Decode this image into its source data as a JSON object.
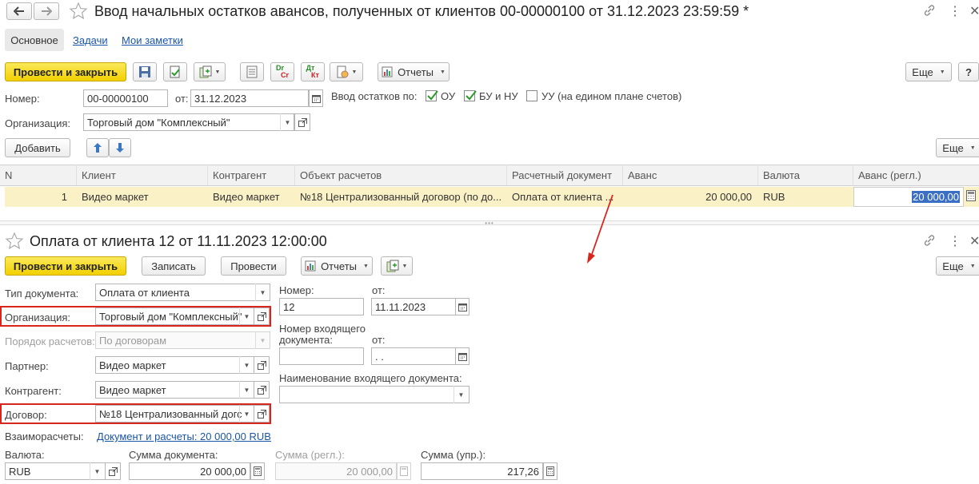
{
  "top_window": {
    "title": "Ввод начальных остатков авансов, полученных от клиентов 00-00000100 от 31.12.2023 23:59:59 *",
    "tabs": [
      "Основное",
      "Задачи",
      "Мои заметки"
    ],
    "toolbar": {
      "post_close": "Провести и закрыть",
      "reports": "Отчеты",
      "more": "Еще",
      "help": "?",
      "dt_label": "Дт",
      "kt_label": "Кт",
      "dr_label": "Dr",
      "cr_label": "Cr"
    },
    "number_label": "Номер:",
    "number_value": "00-00000100",
    "date_label": "от:",
    "date_value": "31.12.2023",
    "input_balances_label": "Ввод остатков по:",
    "checkboxes": [
      {
        "label": "ОУ",
        "checked": true
      },
      {
        "label": "БУ и НУ",
        "checked": true
      },
      {
        "label": "УУ (на едином плане счетов)",
        "checked": false
      }
    ],
    "org_label": "Организация:",
    "org_value": "Торговый дом \"Комплексный\"",
    "add_button": "Добавить",
    "more2": "Еще",
    "table": {
      "headers": [
        "N",
        "Клиент",
        "Контрагент",
        "Объект расчетов",
        "Расчетный документ",
        "Аванс",
        "Валюта",
        "Аванс (регл.)"
      ],
      "rows": [
        {
          "n": "1",
          "client": "Видео маркет",
          "counterparty": "Видео маркет",
          "object": "№18 Централизованный договор (по до...",
          "doc": "Оплата от клиента ...",
          "advance": "20 000,00",
          "currency": "RUB",
          "advance_reg": "20 000,00"
        }
      ]
    }
  },
  "bottom_window": {
    "title": "Оплата от клиента 12 от 11.11.2023 12:00:00",
    "toolbar": {
      "post_close": "Провести и закрыть",
      "save": "Записать",
      "post": "Провести",
      "reports": "Отчеты",
      "more": "Еще"
    },
    "fields": {
      "doc_type_label": "Тип документа:",
      "doc_type_value": "Оплата от клиента",
      "org_label": "Организация:",
      "org_value": "Торговый дом \"Комплексный\"",
      "settlement_order_label": "Порядок расчетов:",
      "settlement_order_value": "По договорам",
      "partner_label": "Партнер:",
      "partner_value": "Видео маркет",
      "counterparty_label": "Контрагент:",
      "counterparty_value": "Видео маркет",
      "contract_label": "Договор:",
      "contract_value": "№18 Централизованный догс",
      "mutual_label": "Взаиморасчеты:",
      "mutual_link": "Документ и расчеты: 20 000,00 RUB",
      "number_label": "Номер:",
      "number_value": "12",
      "date_label": "от:",
      "date_value": "11.11.2023",
      "incoming_num_label_1": "Номер входящего",
      "incoming_num_label_2": "документа:",
      "incoming_date_label": "от:",
      "incoming_date_value": " .  .",
      "incoming_name_label": "Наименование входящего документа:",
      "currency_label": "Валюта:",
      "currency_value": "RUB",
      "doc_sum_label": "Сумма документа:",
      "doc_sum_value": "20 000,00",
      "reg_sum_label": "Сумма (регл.):",
      "reg_sum_value": "20 000,00",
      "mgmt_sum_label": "Сумма (упр.):",
      "mgmt_sum_value": "217,26"
    }
  },
  "colors": {
    "accent_yellow": "#f2d000",
    "highlight_row": "#fbf1c6",
    "red_annotation": "#d9261c",
    "link_blue": "#1a56a8"
  }
}
